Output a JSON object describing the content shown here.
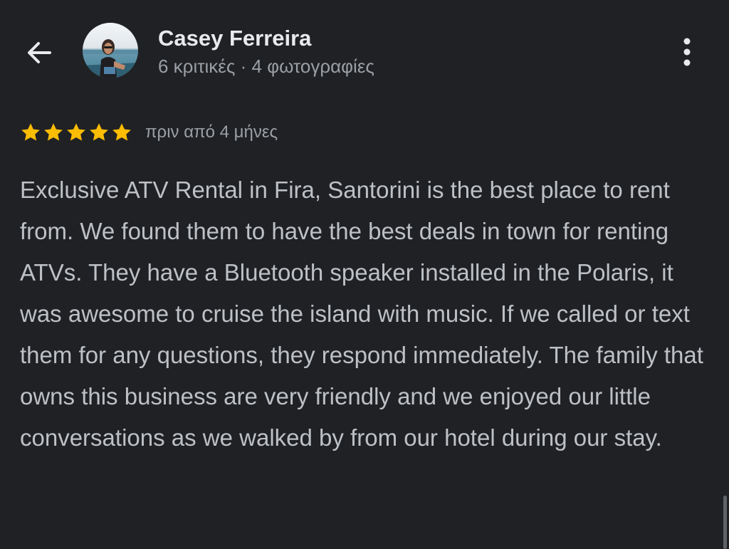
{
  "header": {
    "back_icon": "arrow-back-icon",
    "reviewer_name": "Casey Ferreira",
    "reviewer_stats": "6 κριτικές · 4 φωτογραφίες",
    "more_icon": "more-vert-icon"
  },
  "review": {
    "rating": 5,
    "rating_max": 5,
    "time": "πριν από 4 μήνες",
    "text": "Exclusive ATV Rental in Fira, Santorini is the best place to rent from. We found them to have the best deals in town for renting ATVs. They have a Bluetooth speaker installed in the Polaris, it was awesome to cruise the island with music. If we called or text them for any questions, they respond immediately. The family that owns this business are very friendly and we enjoyed our little conversations as we walked by from our hotel during our stay."
  },
  "colors": {
    "background": "#202124",
    "primary_text": "#e8eaed",
    "secondary_text": "#9aa0a6",
    "body_text": "#bdc1c6",
    "star": "#fbbc04"
  }
}
